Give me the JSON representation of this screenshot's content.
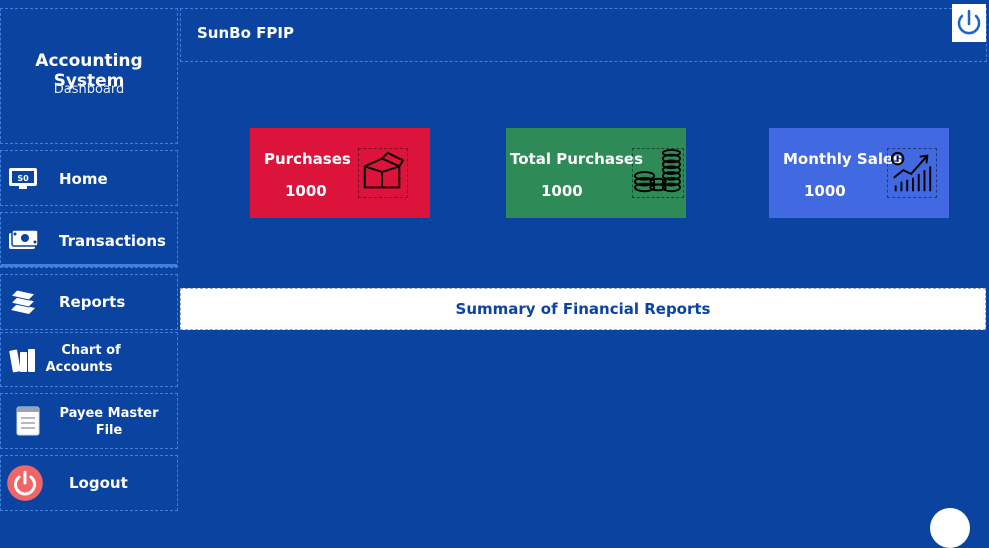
{
  "sidebar": {
    "title": "Accounting System",
    "subtitle": "Dashboard",
    "items": [
      {
        "label": "Home",
        "icon": "monitor-icon"
      },
      {
        "label": "Transactions",
        "icon": "money-icon"
      },
      {
        "label": "Reports",
        "icon": "books-icon"
      },
      {
        "label": "Chart of Accounts",
        "line1": "Chart of",
        "line2": "Accounts",
        "icon": "books-stack-icon"
      },
      {
        "label": "Payee Master File",
        "line1": "Payee Master",
        "line2": "File",
        "icon": "document-icon"
      },
      {
        "label": "Logout",
        "icon": "power-icon"
      }
    ]
  },
  "header": {
    "app_name": "SunBo FPIP",
    "power_icon": "power-icon"
  },
  "cards": [
    {
      "title": "Purchases",
      "value": "1000",
      "color": "#dc143c",
      "icon": "box-icon"
    },
    {
      "title": "Total Purchases",
      "value": "1000",
      "color": "#2e8b57",
      "icon": "coins-icon"
    },
    {
      "title": "Monthly Sales",
      "value": "1000",
      "color": "#4169e1",
      "icon": "growth-chart-icon"
    }
  ],
  "summary": {
    "label": "Summary of Financial Reports"
  },
  "colors": {
    "background": "#0b44a0",
    "accent_white": "#ffffff"
  }
}
